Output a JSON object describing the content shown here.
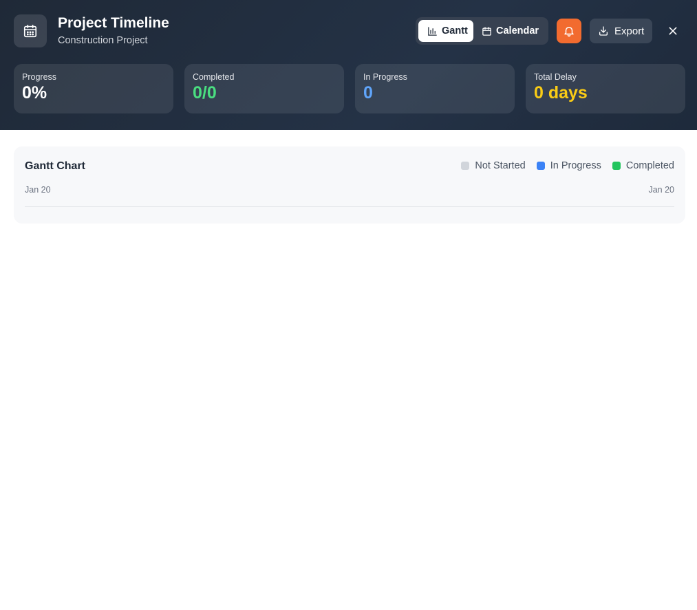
{
  "header": {
    "title": "Project Timeline",
    "subtitle": "Construction Project",
    "app_icon": "calendar-icon",
    "views": [
      {
        "label": "Gantt",
        "icon": "bar-chart-icon",
        "active": true
      },
      {
        "label": "Calendar",
        "icon": "calendar-icon",
        "active": false
      }
    ],
    "notifications_icon": "bell-icon",
    "export_label": "Export",
    "export_icon": "download-icon",
    "close_icon": "close-icon"
  },
  "stats": [
    {
      "label": "Progress",
      "value": "0%",
      "color": "#ffffff"
    },
    {
      "label": "Completed",
      "value": "0/0",
      "color": "#4ade80"
    },
    {
      "label": "In Progress",
      "value": "0",
      "color": "#60a5fa"
    },
    {
      "label": "Total Delay",
      "value": "0 days",
      "color": "#facc15"
    }
  ],
  "gantt": {
    "title": "Gantt Chart",
    "legend": [
      {
        "label": "Not Started",
        "color": "#d1d5db"
      },
      {
        "label": "In Progress",
        "color": "#3b82f6"
      },
      {
        "label": "Completed",
        "color": "#22c55e"
      }
    ],
    "axis_start": "Jan 20",
    "axis_end": "Jan 20"
  },
  "colors": {
    "header_bg": "#1f2937",
    "accent_orange": "#f26b2f"
  }
}
